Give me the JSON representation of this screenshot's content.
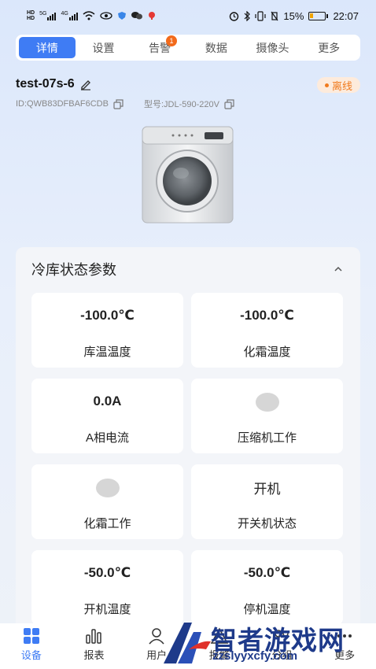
{
  "status_bar": {
    "left_icons": [
      "hd-icon",
      "5g-signal-icon",
      "4g-signal-icon",
      "wifi-icon",
      "eye-icon",
      "app-icon",
      "wechat-icon",
      "notification-icon"
    ],
    "left_labels": [
      "5G",
      "4G"
    ],
    "battery": "15%",
    "time": "22:07"
  },
  "tabs": [
    {
      "label": "详情",
      "active": true
    },
    {
      "label": "设置"
    },
    {
      "label": "告警",
      "badge": "1"
    },
    {
      "label": "数据"
    },
    {
      "label": "摄像头"
    },
    {
      "label": "更多"
    }
  ],
  "device": {
    "name": "test-07s-6",
    "status": "离线",
    "id": "ID:QWB83DFBAF6CDB",
    "model": "型号:JDL-590-220V",
    "image": "washing-machine"
  },
  "panel": {
    "title": "冷库状态参数",
    "cards": [
      {
        "value": "-100.0℃",
        "label": "库温温度"
      },
      {
        "value": "-100.0℃",
        "label": "化霜温度"
      },
      {
        "value": "0.0A",
        "label": "A相电流"
      },
      {
        "value": "",
        "indicator": "gray-dot",
        "label": "压缩机工作"
      },
      {
        "value": "",
        "indicator": "gray-dot",
        "label": "化霜工作"
      },
      {
        "value": "开机",
        "label": "开关机状态"
      },
      {
        "value": "-50.0℃",
        "label": "开机温度"
      },
      {
        "value": "-50.0℃",
        "label": "停机温度"
      }
    ]
  },
  "bottom_nav": [
    {
      "label": "设备",
      "icon": "grid-icon",
      "active": true
    },
    {
      "label": "报表",
      "icon": "bar-chart-icon"
    },
    {
      "label": "用户",
      "icon": "user-icon"
    },
    {
      "label": "报警",
      "icon": "alert-icon"
    },
    {
      "label": "分组",
      "icon": "group-icon"
    },
    {
      "label": "更多",
      "icon": "more-icon"
    }
  ],
  "watermark": {
    "title": "智者游戏网",
    "url": "zzslyyxcfy.com"
  },
  "colors": {
    "accent": "#3f7cf4",
    "offline": "#f07a1e",
    "badge": "#f26a1b"
  }
}
